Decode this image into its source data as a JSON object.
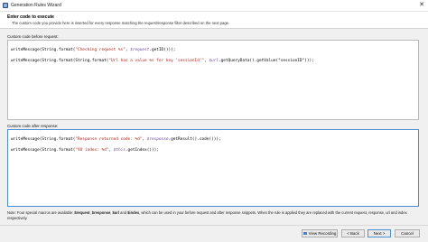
{
  "window": {
    "title": "Generation Rules Wizard",
    "close_glyph": "✕"
  },
  "header": {
    "title": "Enter code to execute",
    "description": "The custom code you provide here is inserted for every response matching the request/response filter described on the next page."
  },
  "before_request": {
    "label": "Custom code before request:",
    "lines": [
      [
        "writeMessage(String.format(",
        "\"Checking request %s\"",
        ", ",
        "$request",
        ".getID()));"
      ],
      [
        "writeMessage(String.format(String.format(",
        "\"Url has a value %s for key 'sessionId'\"",
        ", ",
        "$url",
        ".getQueryData().getValue(\"sessionID\")));"
      ]
    ]
  },
  "after_response": {
    "label": "Custom code after response:",
    "lines": [
      [
        "writeMessage(String.format(",
        "\"Response returned code: %d\"",
        ", ",
        "$response",
        ".getResult().code()));"
      ],
      [
        "writeMessage(String.format(",
        "\"VU index: %d\"",
        ", ",
        "$this",
        ".getIndex()));"
      ]
    ]
  },
  "note": {
    "prefix": "Note: Four special macros are available: ",
    "macros": [
      "$request",
      "$response",
      "$url",
      "$index"
    ],
    "sep1": ", ",
    "sep_and": " and ",
    "suffix": ", which can be used in your before request and after response snippets. When the rule is applied they are replaced with the current request, response, url and index respectively."
  },
  "buttons": {
    "view_recording": "View Recording",
    "back": "< Back",
    "next": "Next >",
    "cancel": "Cancel"
  },
  "colors": {
    "keyword": "#0b3f9c",
    "string": "#b01e12",
    "macro": "#6f4aa0",
    "focus_border": "#4a8fd6"
  },
  "icons": {
    "app": "wizard-icon",
    "recording": "recording-icon",
    "close": "close-icon"
  }
}
